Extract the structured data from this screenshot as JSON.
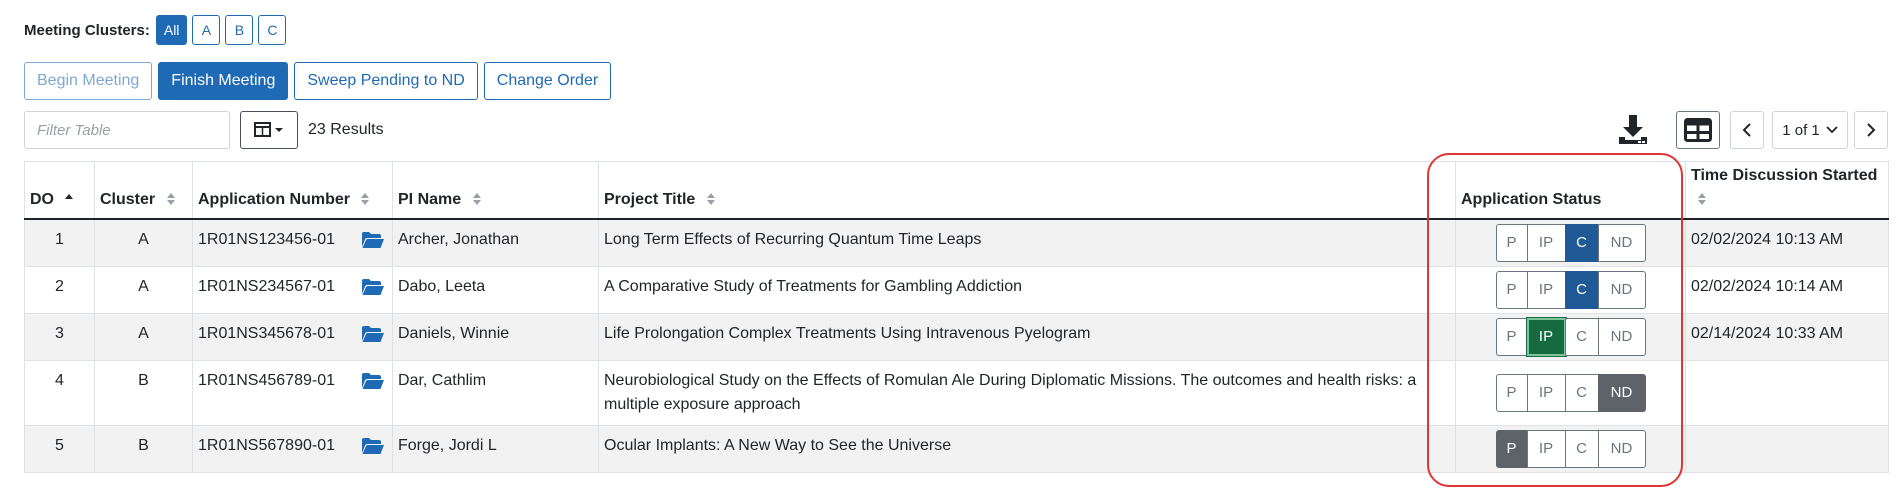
{
  "clusters": {
    "label": "Meeting Clusters:",
    "options": [
      "All",
      "A",
      "B",
      "C"
    ],
    "selected": "All"
  },
  "actions": {
    "begin": "Begin Meeting",
    "finish": "Finish Meeting",
    "sweep": "Sweep Pending to ND",
    "change_order": "Change Order"
  },
  "toolbar": {
    "filter_placeholder": "Filter Table",
    "results": "23 Results",
    "page": "1 of 1"
  },
  "table": {
    "headers": {
      "do": "DO",
      "cluster": "Cluster",
      "app_number": "Application Number",
      "pi_name": "PI Name",
      "project_title": "Project Title",
      "status": "Application Status",
      "time": "Time Discussion Started"
    },
    "status_options": [
      "P",
      "IP",
      "C",
      "ND"
    ],
    "rows": [
      {
        "do": "1",
        "cluster": "A",
        "app_number": "1R01NS123456-01",
        "pi_name": "Archer, Jonathan",
        "title": "Long Term Effects of Recurring  Quantum Time Leaps",
        "status": "C",
        "time": "02/02/2024 10:13 AM"
      },
      {
        "do": "2",
        "cluster": "A",
        "app_number": "1R01NS234567-01",
        "pi_name": "Dabo, Leeta",
        "title": "A Comparative Study of Treatments for Gambling Addiction",
        "status": "C",
        "time": "02/02/2024 10:14 AM"
      },
      {
        "do": "3",
        "cluster": "A",
        "app_number": "1R01NS345678-01",
        "pi_name": "Daniels, Winnie",
        "title": "Life Prolongation Complex Treatments Using Intravenous Pyelogram",
        "status": "IP",
        "time": "02/14/2024 10:33 AM"
      },
      {
        "do": "4",
        "cluster": "B",
        "app_number": "1R01NS456789-01",
        "pi_name": "Dar, Cathlim",
        "title": "Neurobiological Study on the Effects of Romulan Ale During Diplomatic Missions. The outcomes and health risks: a multiple exposure approach",
        "status": "ND",
        "time": ""
      },
      {
        "do": "5",
        "cluster": "B",
        "app_number": "1R01NS567890-01",
        "pi_name": "Forge, Jordi L",
        "title": "Ocular Implants: A New Way to See the Universe",
        "status": "P",
        "time": ""
      }
    ]
  },
  "colors": {
    "primary": "#1f6ab4",
    "status_c": "#1f5a96",
    "status_ip": "#156b3f",
    "status_gray": "#5d6369",
    "highlight": "#e03535"
  }
}
